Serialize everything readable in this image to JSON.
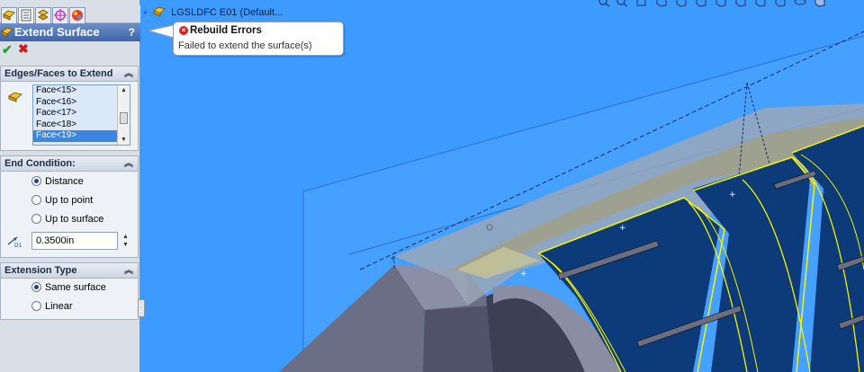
{
  "feature": {
    "title": "Extend Surface",
    "help_label": "?"
  },
  "edges_group": {
    "title": "Edges/Faces to Extend",
    "items": [
      "Face<15>",
      "Face<16>",
      "Face<17>",
      "Face<18>",
      "Face<19>"
    ],
    "selected_item": "Face<19>"
  },
  "end_condition": {
    "title": "End Condition:",
    "options": [
      "Distance",
      "Up to point",
      "Up to surface"
    ],
    "selected": "Distance",
    "distance_value": "0.3500in"
  },
  "extension_type": {
    "title": "Extension Type",
    "options": [
      "Same surface",
      "Linear"
    ],
    "selected": "Same surface"
  },
  "feature_tree": {
    "part_label": "LGSLDFC E01  (Default..."
  },
  "error_callout": {
    "title": "Rebuild Errors",
    "message": "Failed to extend the surface(s)"
  },
  "colors": {
    "viewport_background": "#3d9bff",
    "panel_title": "#3e64a8",
    "error_red": "#d92020",
    "ok_green": "#1fa31f",
    "surface_navy": "#0d3a78",
    "selection_yellow": "#f5f500"
  },
  "icons": [
    "part-icon",
    "feature-manager-tab-icon",
    "property-manager-tab-icon",
    "configuration-manager-tab-icon",
    "dimxpert-tab-icon",
    "display-manager-tab-icon",
    "face-selection-icon",
    "distance-icon",
    "ok-check-icon",
    "cancel-x-icon",
    "error-icon",
    "zoom-to-fit-icon",
    "zoom-area-icon",
    "view-orientation-icon",
    "display-style-icon"
  ]
}
